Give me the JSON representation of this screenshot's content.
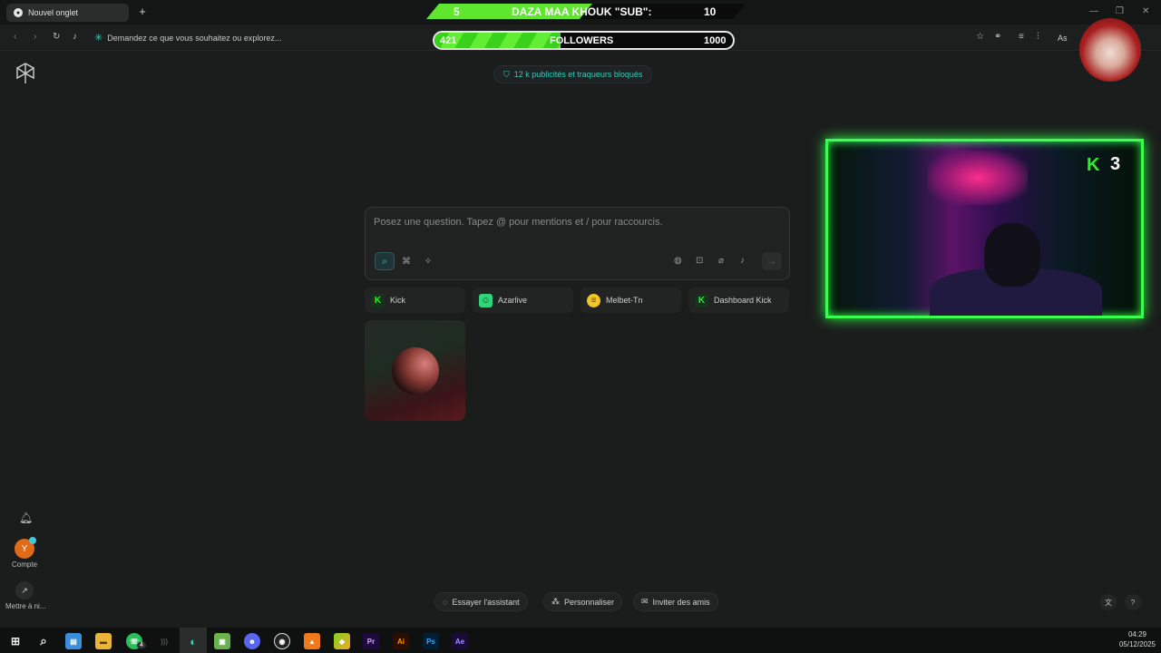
{
  "browser": {
    "tab_title": "Nouvel onglet",
    "new_tab": "+",
    "address_placeholder": "Demandez ce que vous souhaitez ou explorez...",
    "assistant_label": "As"
  },
  "overlay": {
    "sub_goal_left": "5",
    "sub_goal_label": "DAZA MAA KHOUK \"SUB\":",
    "sub_goal_target": "10",
    "sub_goal_progress": 0.5,
    "followers_current": "421",
    "followers_label": "FOLLOWERS",
    "followers_target": "1000",
    "followers_progress": 0.421,
    "kick_count": "3"
  },
  "sidebar": {
    "account_initial": "Y",
    "account_label": "Compte",
    "update_label": "Mettre à ni..."
  },
  "main": {
    "ad_badge": "12 k publicités et traqueurs bloqués",
    "ask_placeholder": "Posez une question. Tapez @ pour mentions et / pour raccourcis.",
    "shortcuts": [
      {
        "label": "Kick",
        "icon": "kick-icon",
        "color": "#2df02d"
      },
      {
        "label": "Azarlive",
        "icon": "azarlive-icon",
        "color": "#2ed67a"
      },
      {
        "label": "Melbet-Tn",
        "icon": "melbet-icon",
        "color": "#f3c623"
      },
      {
        "label": "Dashboard Kick",
        "icon": "kick-icon",
        "color": "#2df02d"
      }
    ]
  },
  "bottom": {
    "try_assistant": "Essayer l'assistant",
    "personalize": "Personnaliser",
    "invite": "Inviter des amis",
    "help": "?"
  },
  "taskbar": {
    "time": "04:29",
    "date": "05/12/2025",
    "whatsapp_badge": "4",
    "apps": [
      "windows-start-icon",
      "search-icon",
      "files-icon",
      "explorer-icon",
      "whatsapp-icon",
      "wifi-icon",
      "browser-icon",
      "android-icon",
      "discord-icon",
      "obs-icon",
      "vlc-icon",
      "bluestacks-icon",
      "premiere-icon",
      "illustrator-icon",
      "photoshop-icon",
      "after-effects-icon"
    ],
    "premiere": "Pr",
    "illustrator": "Ai",
    "photoshop": "Ps",
    "after_effects": "Ae"
  },
  "colors": {
    "accent": "#42c8c0",
    "overlay_green": "#3cff52",
    "background": "#1b1c1c"
  }
}
